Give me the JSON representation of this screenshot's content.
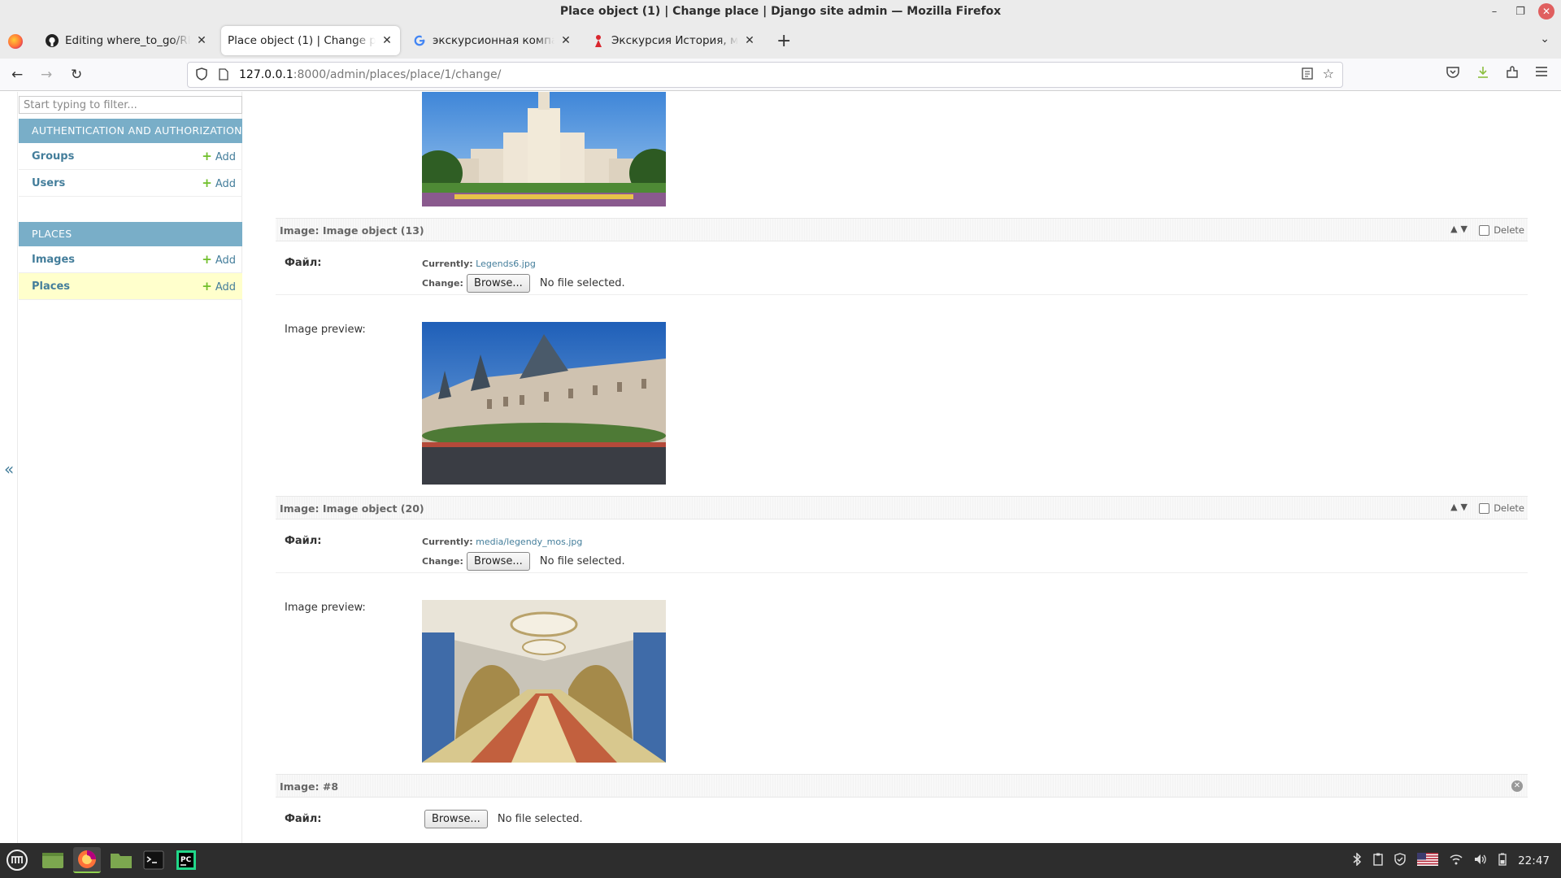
{
  "window": {
    "title": "Place object (1) | Change place | Django site admin — Mozilla Firefox"
  },
  "tabs": [
    {
      "label": "Editing where_to_go/README.md",
      "favicon": "github-icon"
    },
    {
      "label": "Place object (1) | Change place | Django site admin",
      "favicon": "none"
    },
    {
      "label": "экскурсионная компания - Google",
      "favicon": "google-icon"
    },
    {
      "label": "Экскурсия История, мифы",
      "favicon": "tripster-icon"
    }
  ],
  "url": {
    "host": "127.0.0.1",
    "rest": ":8000/admin/places/place/1/change/"
  },
  "sidebar": {
    "filter_placeholder": "Start typing to filter...",
    "collapse_label": "«",
    "modules": [
      {
        "caption": "AUTHENTICATION AND AUTHORIZATION",
        "models": [
          {
            "name": "Groups",
            "add": "Add"
          },
          {
            "name": "Users",
            "add": "Add"
          }
        ]
      },
      {
        "caption": "PLACES",
        "models": [
          {
            "name": "Images",
            "add": "Add"
          },
          {
            "name": "Places",
            "add": "Add"
          }
        ]
      }
    ]
  },
  "inlines": [
    {
      "title": "Image: Image object (13)",
      "delete_label": "Delete",
      "file_label": "Файл:",
      "currently_label": "Currently:",
      "currently_value": "Legends6.jpg",
      "change_label": "Change:",
      "browse_label": "Browse...",
      "no_file": "No file selected.",
      "preview_label": "Image preview:"
    },
    {
      "title": "Image: Image object (20)",
      "delete_label": "Delete",
      "file_label": "Файл:",
      "currently_label": "Currently:",
      "currently_value": "media/legendy_mos.jpg",
      "change_label": "Change:",
      "browse_label": "Browse...",
      "no_file": "No file selected.",
      "preview_label": "Image preview:"
    },
    {
      "title": "Image: #8",
      "file_label": "Файл:",
      "browse_label": "Browse...",
      "no_file": "No file selected."
    }
  ],
  "taskbar": {
    "clock": "22:47"
  },
  "colors": {
    "admin_blue": "#79aec8",
    "link": "#447e9b",
    "add_green": "#70bf2b",
    "current_row": "#ffffcc"
  }
}
